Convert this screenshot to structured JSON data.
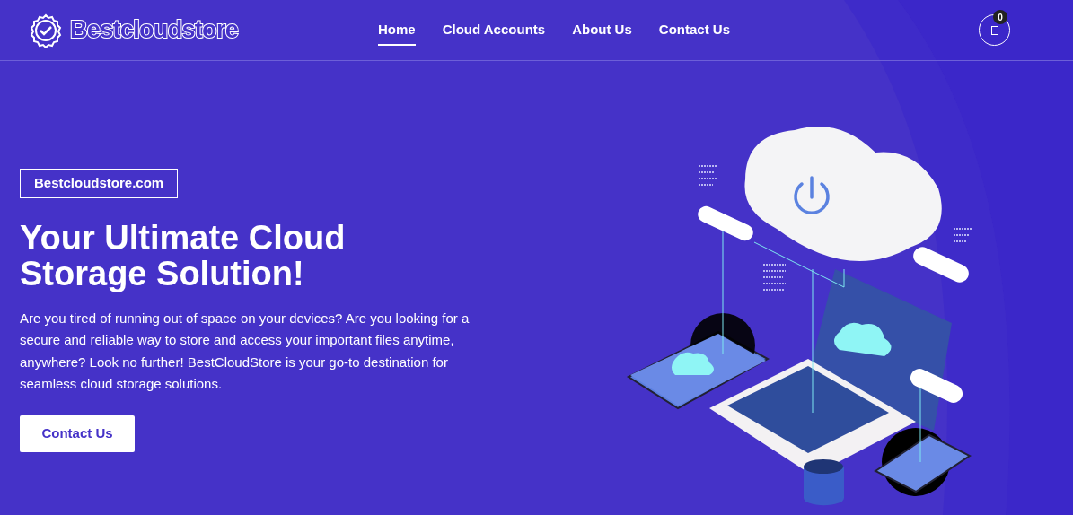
{
  "brand": {
    "name": "Bestcloudstore"
  },
  "nav": [
    {
      "label": "Home",
      "selected": true
    },
    {
      "label": "Cloud Accounts",
      "selected": false
    },
    {
      "label": "About Us",
      "selected": false
    },
    {
      "label": "Contact Us",
      "selected": false
    }
  ],
  "cart": {
    "count": "0"
  },
  "hero": {
    "tag": "Bestcloudstore.com",
    "title": "Your Ultimate Cloud Storage Solution!",
    "text": "Are you tired of running out of space on your devices? Are you looking for a secure and reliable way to store and access your important files anytime, anywhere? Look no further! BestCloudStore is your go-to destination for seamless cloud storage solutions.",
    "button": "Contact Us"
  }
}
